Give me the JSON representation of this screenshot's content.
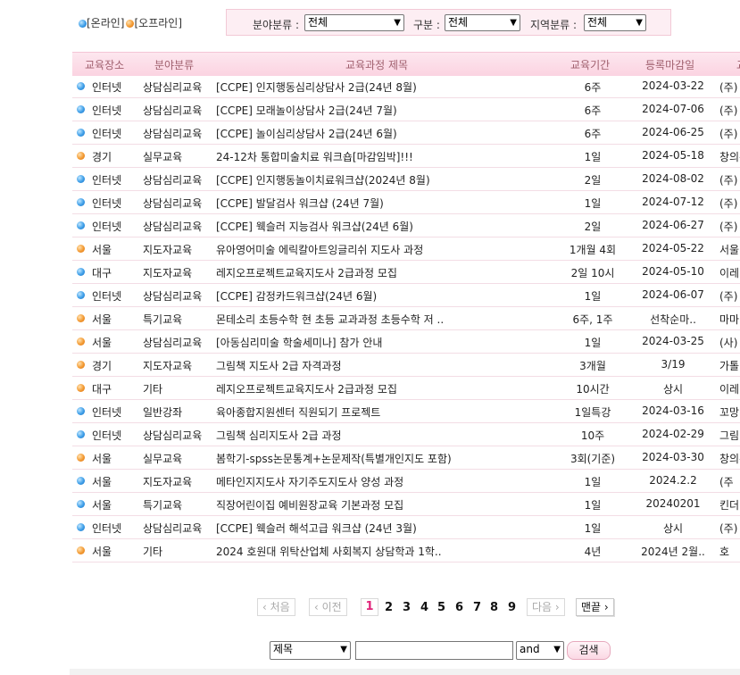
{
  "legend": {
    "online": "[온라인]",
    "offline": "[오프라인]"
  },
  "filters": {
    "field_label": "분야분류 :",
    "field_value": "전체",
    "type_label": "구분 :",
    "type_value": "전체",
    "region_label": "지역분류 :",
    "region_value": "전체"
  },
  "columns": [
    "교육장소",
    "분야분류",
    "교육과정 제목",
    "교육기간",
    "등록마감일",
    "교"
  ],
  "rows": [
    {
      "mode": "online",
      "place": "인터넷",
      "field": "상담심리교육",
      "title": "[CCPE] 인지행동심리상담사 2급(24년 8월)",
      "period": "6주",
      "deadline": "2024-03-22",
      "org": "(주)"
    },
    {
      "mode": "online",
      "place": "인터넷",
      "field": "상담심리교육",
      "title": "[CCPE] 모래놀이상담사 2급(24년 7월)",
      "period": "6주",
      "deadline": "2024-07-06",
      "org": "(주)"
    },
    {
      "mode": "online",
      "place": "인터넷",
      "field": "상담심리교육",
      "title": "[CCPE] 놀이심리상담사 2급(24년 6월)",
      "period": "6주",
      "deadline": "2024-06-25",
      "org": "(주)"
    },
    {
      "mode": "offline",
      "place": "경기",
      "field": "실무교육",
      "title": "24-12차 통합미술치료 워크숍[마감임박]!!!",
      "period": "1일",
      "deadline": "2024-05-18",
      "org": "창의수"
    },
    {
      "mode": "online",
      "place": "인터넷",
      "field": "상담심리교육",
      "title": "[CCPE] 인지행동놀이치료워크샵(2024년 8월)",
      "period": "2일",
      "deadline": "2024-08-02",
      "org": "(주)"
    },
    {
      "mode": "online",
      "place": "인터넷",
      "field": "상담심리교육",
      "title": "[CCPE] 발달검사 워크샵 (24년 7월)",
      "period": "1일",
      "deadline": "2024-07-12",
      "org": "(주)"
    },
    {
      "mode": "online",
      "place": "인터넷",
      "field": "상담심리교육",
      "title": "[CCPE] 웩슬러 지능검사 워크샵(24년 6월)",
      "period": "2일",
      "deadline": "2024-06-27",
      "org": "(주)"
    },
    {
      "mode": "offline",
      "place": "서울",
      "field": "지도자교육",
      "title": "유아영어미술 에릭칼아트잉글리쉬 지도사 과정",
      "period": "1개월 4회",
      "deadline": "2024-05-22",
      "org": "서울."
    },
    {
      "mode": "online",
      "place": "대구",
      "field": "지도자교육",
      "title": "레지오프로젝트교육지도사 2급과정 모집",
      "period": "2일 10시",
      "deadline": "2024-05-10",
      "org": "이레"
    },
    {
      "mode": "online",
      "place": "인터넷",
      "field": "상담심리교육",
      "title": "[CCPE] 감정카드워크샵(24년 6월)",
      "period": "1일",
      "deadline": "2024-06-07",
      "org": "(주)"
    },
    {
      "mode": "offline",
      "place": "서울",
      "field": "특기교육",
      "title": "몬테소리 초등수학 현 초등 교과과정 초등수학 저 ..",
      "period": "6주, 1주",
      "deadline": "선착순마..",
      "org": "마마"
    },
    {
      "mode": "offline",
      "place": "서울",
      "field": "상담심리교육",
      "title": "[아동심리미술 학술세미나] 참가 안내",
      "period": "1일",
      "deadline": "2024-03-25",
      "org": "(사)"
    },
    {
      "mode": "offline",
      "place": "경기",
      "field": "지도자교육",
      "title": "그림책 지도사 2급 자격과정",
      "period": "3개월",
      "deadline": "3/19",
      "org": "가톨"
    },
    {
      "mode": "offline",
      "place": "대구",
      "field": "기타",
      "title": "레지오프로젝트교육지도사 2급과정 모집",
      "period": "10시간",
      "deadline": "상시",
      "org": "이레"
    },
    {
      "mode": "online",
      "place": "인터넷",
      "field": "일반강좌",
      "title": "육아종합지원센터 직원되기 프로젝트",
      "period": "1일특강",
      "deadline": "2024-03-16",
      "org": "꼬망"
    },
    {
      "mode": "online",
      "place": "인터넷",
      "field": "상담심리교육",
      "title": "그림책 심리지도사 2급 과정",
      "period": "10주",
      "deadline": "2024-02-29",
      "org": "그림"
    },
    {
      "mode": "offline",
      "place": "서울",
      "field": "실무교육",
      "title": "봄학기-spss논문통계+논문제작(특별개인지도 포함)",
      "period": "3회(기준)",
      "deadline": "2024-03-30",
      "org": "창의수"
    },
    {
      "mode": "online",
      "place": "서울",
      "field": "지도자교육",
      "title": "메타인지지도사 자기주도지도사 양성 과정",
      "period": "1일",
      "deadline": "2024.2.2",
      "org": "(주"
    },
    {
      "mode": "online",
      "place": "서울",
      "field": "특기교육",
      "title": "직장어린이집 예비원장교육 기본과정 모집",
      "period": "1일",
      "deadline": "20240201",
      "org": "킨더"
    },
    {
      "mode": "online",
      "place": "인터넷",
      "field": "상담심리교육",
      "title": "[CCPE] 웩슬러 해석고급 워크샵 (24년 3월)",
      "period": "1일",
      "deadline": "상시",
      "org": "(주)"
    },
    {
      "mode": "offline",
      "place": "서울",
      "field": "기타",
      "title": "2024 호원대 위탁산업체 사회복지 상담학과 1학..",
      "period": "4년",
      "deadline": "2024년 2월..",
      "org": "호"
    }
  ],
  "pager": {
    "first": "‹ 처음",
    "prev": "‹ 이전",
    "current": "1",
    "pages": [
      "2",
      "3",
      "4",
      "5",
      "6",
      "7",
      "8",
      "9"
    ],
    "next": "다음 ›",
    "last": "맨끝 ›"
  },
  "search": {
    "field_value": "제목",
    "operator_value": "and",
    "button": "검색",
    "query": ""
  }
}
